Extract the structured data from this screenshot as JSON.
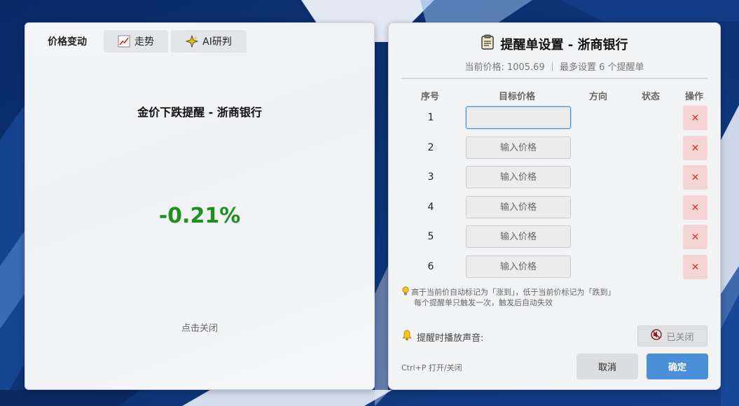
{
  "left": {
    "tabs": [
      {
        "label": "价格变动",
        "icon": "none",
        "active": true
      },
      {
        "label": "走势",
        "icon": "chart-line-icon",
        "active": false
      },
      {
        "label": "AI研判",
        "icon": "sparkle-icon",
        "active": false
      }
    ],
    "alert_title": "金价下跌提醒 - 浙商银行",
    "change_pct": "-0.21%",
    "close_hint": "点击关闭"
  },
  "right": {
    "title": "提醒单设置 - 浙商银行",
    "subtitle": "当前价格: 1005.69 ｜ 最多设置 6 个提醒单",
    "columns": [
      "序号",
      "目标价格",
      "方向",
      "状态",
      "操作"
    ],
    "rows": [
      {
        "index": "1",
        "value": "",
        "placeholder": ""
      },
      {
        "index": "2",
        "value": "",
        "placeholder": "输入价格"
      },
      {
        "index": "3",
        "value": "",
        "placeholder": "输入价格"
      },
      {
        "index": "4",
        "value": "",
        "placeholder": "输入价格"
      },
      {
        "index": "5",
        "value": "",
        "placeholder": "输入价格"
      },
      {
        "index": "6",
        "value": "",
        "placeholder": "输入价格"
      }
    ],
    "delete_symbol": "✕",
    "hint_line1": "高于当前价自动标记为「涨到」，低于当前价标记为「跌到」",
    "hint_line2": "每个提醒单只触发一次，触发后自动失效",
    "sound_label": "提醒时播放声音:",
    "sound_button": "已关闭",
    "shortcut": "Ctrl+P 打开/关闭",
    "cancel": "取消",
    "confirm": "确定"
  },
  "colors": {
    "positive_down": "#1f8f1f",
    "primary": "#4a8fd8",
    "danger_bg": "#f5d4d4",
    "danger_fg": "#d23434"
  }
}
